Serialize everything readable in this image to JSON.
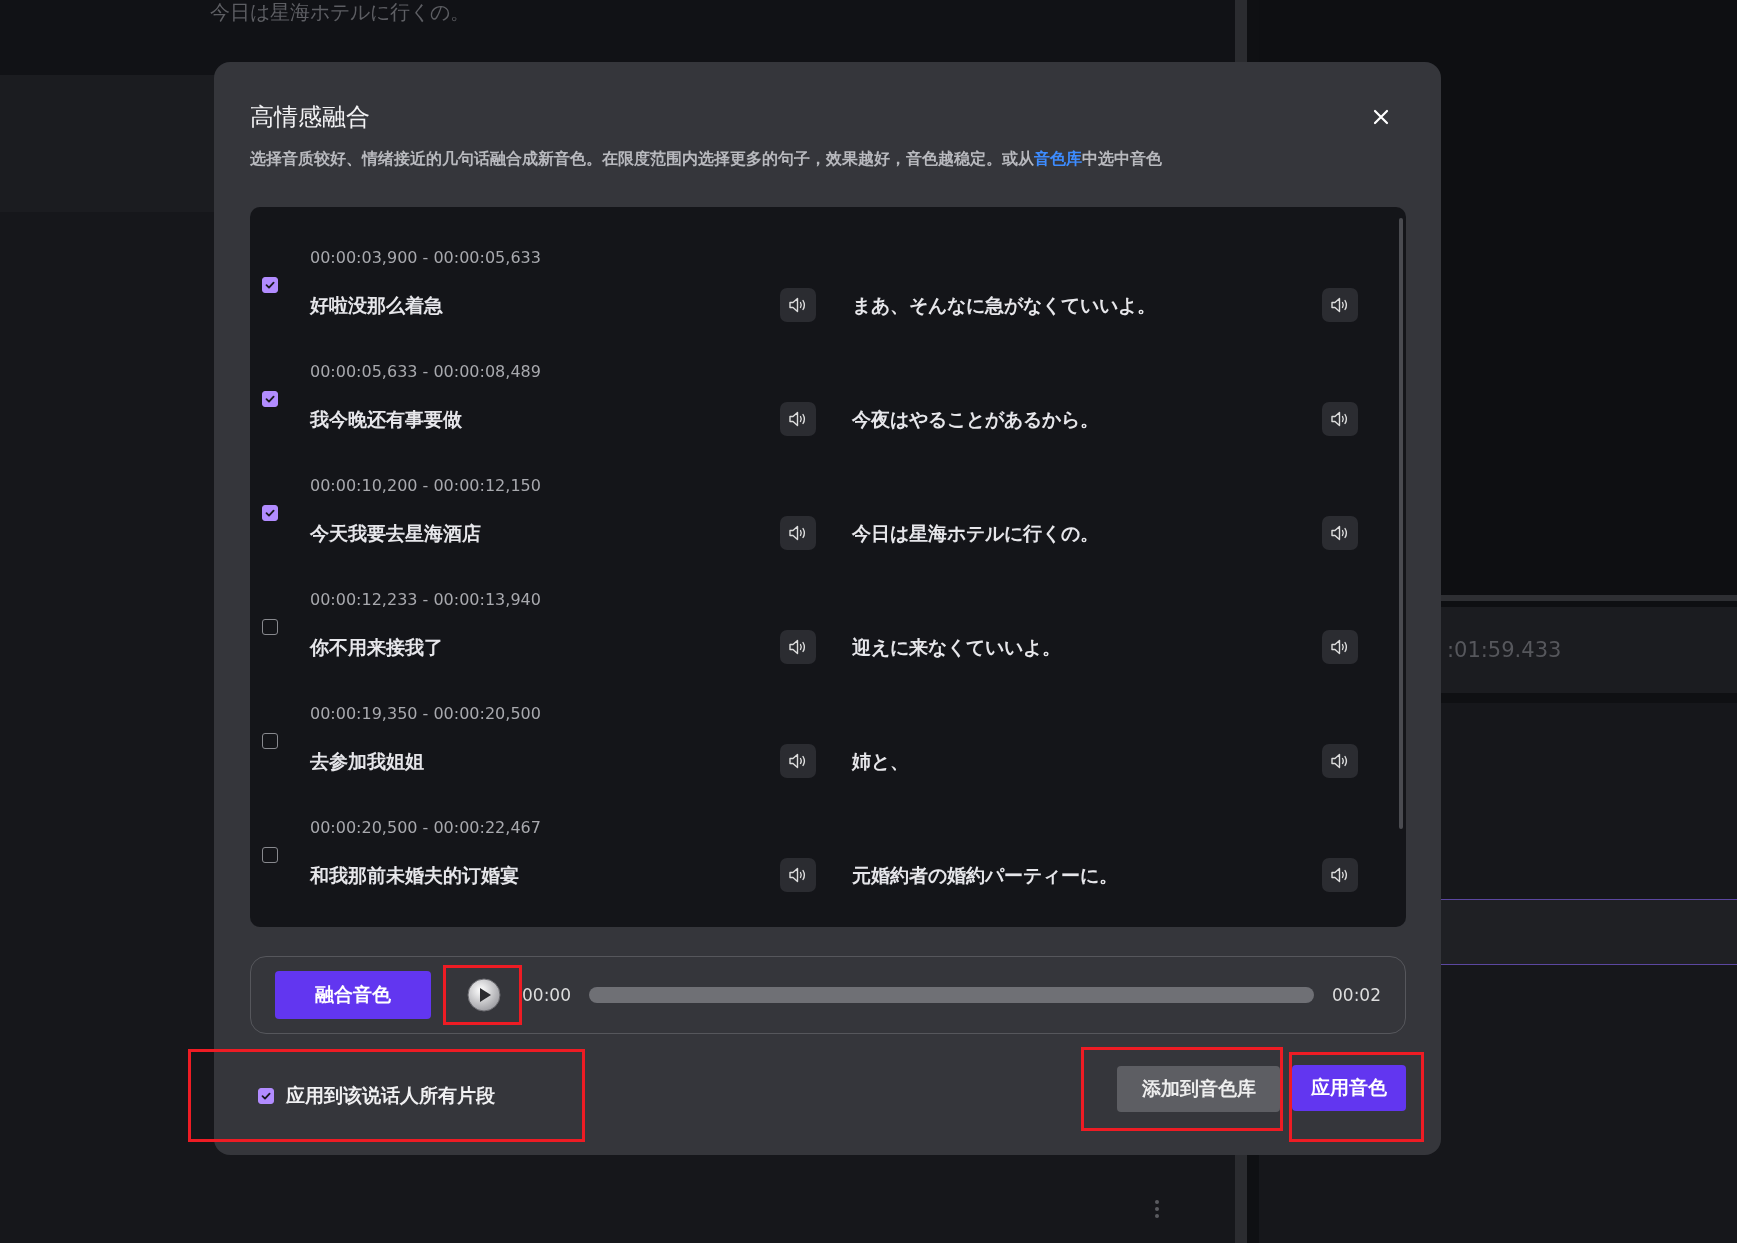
{
  "background": {
    "subtitle": "今日は星海ホテルに行くの。",
    "timecode": ":01:59.433"
  },
  "dialog": {
    "title": "高情感融合",
    "description": {
      "before": "选择音质较好、情绪接近的几句话融合成新音色。在限度范围内选择更多的句子，效果越好，音色越稳定。或从",
      "link": "音色库",
      "after": "中选中音色"
    }
  },
  "segments": [
    {
      "checked": true,
      "time": "00:00:03,900 - 00:00:05,633",
      "source": "好啦没那么着急",
      "translation": "まあ、そんなに急がなくていいよ。"
    },
    {
      "checked": true,
      "time": "00:00:05,633 - 00:00:08,489",
      "source": "我今晚还有事要做",
      "translation": "今夜はやることがあるから。"
    },
    {
      "checked": true,
      "time": "00:00:10,200 - 00:00:12,150",
      "source": "今天我要去星海酒店",
      "translation": "今日は星海ホテルに行くの。"
    },
    {
      "checked": false,
      "time": "00:00:12,233 - 00:00:13,940",
      "source": "你不用来接我了",
      "translation": "迎えに来なくていいよ。"
    },
    {
      "checked": false,
      "time": "00:00:19,350 - 00:00:20,500",
      "source": "去参加我姐姐",
      "translation": "姉と、"
    },
    {
      "checked": false,
      "time": "00:00:20,500 - 00:00:22,467",
      "source": "和我那前未婚夫的订婚宴",
      "translation": "元婚約者の婚約パーティーに。"
    }
  ],
  "player": {
    "button": "融合音色",
    "current": "00:00",
    "duration": "00:02"
  },
  "apply_all": {
    "label": "应用到该说话人所有片段",
    "checked": true
  },
  "buttons": [
    {
      "label": "添加到音色库",
      "kind": "secondary"
    },
    {
      "label": "应用音色",
      "kind": "primary"
    }
  ]
}
